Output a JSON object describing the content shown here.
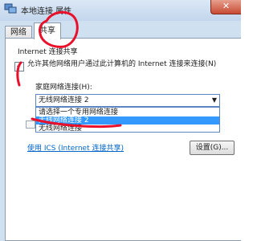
{
  "window": {
    "title": "本地连接 属性",
    "close_label": "✕"
  },
  "tabs": [
    {
      "label": "网络"
    },
    {
      "label": "共享"
    }
  ],
  "sharing": {
    "group_label": "Internet 连接共享",
    "allow_checkbox_checked": true,
    "allow_checkbox_mark": "✓",
    "allow_text": "允许其他网络用户通过此计算机的 Internet 连接来连接(N)",
    "home_network_label": "家庭网络连接(H):",
    "select_value": "无线网络连接 2",
    "dropdown_options": [
      "请选择一个专用网络连接",
      "无线网络连接 2",
      "无线网络连接"
    ],
    "highlighted_option_index": 1,
    "ics_link": "使用 ICS (Internet 连接共享)",
    "settings_button": "设置(G)..."
  },
  "colors": {
    "chrome": "#cfe0f1",
    "highlight": "#3399ff",
    "annotation": "#e8102a"
  }
}
